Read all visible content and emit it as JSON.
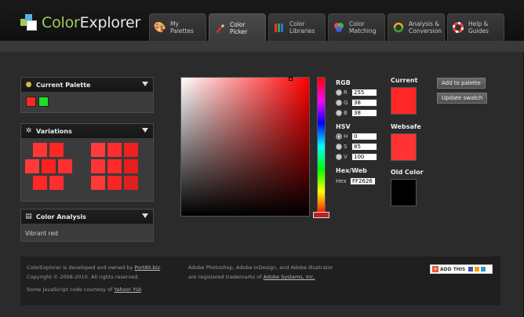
{
  "app": {
    "logo_text_1": "Color",
    "logo_text_2": "Explorer"
  },
  "tabs": [
    {
      "label": "My\nPalettes",
      "icon": "palette-icon",
      "active": false
    },
    {
      "label": "Color\nPicker",
      "icon": "brush-icon",
      "active": true
    },
    {
      "label": "Color\nLibraries",
      "icon": "library-icon",
      "active": false
    },
    {
      "label": "Color\nMatching",
      "icon": "color-wheel-icon",
      "active": false
    },
    {
      "label": "Analysis &\nConversion",
      "icon": "analysis-icon",
      "active": false
    },
    {
      "label": "Help &\nGuides",
      "icon": "lifebuoy-icon",
      "active": false
    }
  ],
  "current_palette": {
    "title": "Current Palette",
    "swatches": [
      "#ff2626",
      "#22dd22"
    ]
  },
  "variations": {
    "title": "Variations",
    "colors_left": [
      "#ff3636",
      "#ff2626",
      "#ff3a3a",
      "#ff2020",
      "#ff3030",
      "#ff2828",
      "#ff2e2e",
      "#ff2424"
    ],
    "colors_right": [
      "#ff3b3b",
      "#ff2d2d",
      "#f02020",
      "#ff3434",
      "#ff2a2a",
      "#e81e1e",
      "#ff3838",
      "#f52525",
      "#e02020"
    ]
  },
  "color_analysis": {
    "title": "Color Analysis",
    "text": "Vibrant red"
  },
  "rgb": {
    "title": "RGB",
    "fields": [
      {
        "label": "R",
        "value": "255"
      },
      {
        "label": "G",
        "value": "38"
      },
      {
        "label": "B",
        "value": "38"
      }
    ]
  },
  "hsv": {
    "title": "HSV",
    "fields": [
      {
        "label": "H",
        "value": "0"
      },
      {
        "label": "S",
        "value": "85"
      },
      {
        "label": "V",
        "value": "100"
      }
    ]
  },
  "hexweb": {
    "title": "Hex/Web",
    "label": "Hex",
    "value": "FF2626"
  },
  "swatches": {
    "current_label": "Current",
    "current_color": "#ff2626",
    "websafe_label": "Websafe",
    "websafe_color": "#ff3333",
    "old_label": "Old Color",
    "old_color": "#000000"
  },
  "buttons": {
    "add_to_palette": "Add to palette",
    "update_swatch": "Update swatch"
  },
  "footer": {
    "line1_pre": "ColorExplorer is developed and owned by ",
    "line1_link": "Port80.biz",
    "line1_post": ".",
    "line2": "Copyright © 2008-2010. All rights reserved.",
    "line3_pre": "Some JavaScript code courtesy of ",
    "line3_link": "Yahoo! YUI",
    "line3_post": ".",
    "trademark1": "Adobe Photoshop, Adobe InDesign, and Adobe Illustrator",
    "trademark2_pre": "are registered trademarks of ",
    "trademark2_link": "Adobe Systems, Inc.",
    "addthis": "ADD THIS"
  }
}
